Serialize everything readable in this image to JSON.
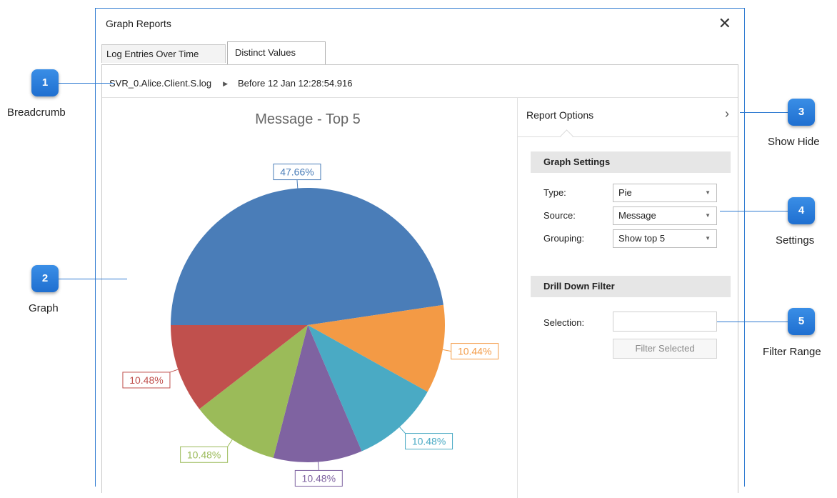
{
  "window": {
    "title": "Graph Reports",
    "close_symbol": "✕"
  },
  "tabs": [
    {
      "label": "Log Entries Over Time"
    },
    {
      "label": "Distinct Values"
    }
  ],
  "breadcrumb": {
    "items": [
      "SVR_0.Alice.Client.S.log",
      "Before 12 Jan 12:28:54.916"
    ]
  },
  "report_options": {
    "title": "Report Options",
    "toggle_symbol": "›",
    "graph_settings": {
      "header": "Graph Settings",
      "type_label": "Type:",
      "type_value": "Pie",
      "source_label": "Source:",
      "source_value": "Message",
      "grouping_label": "Grouping:",
      "grouping_value": "Show top 5"
    },
    "drill_down": {
      "header": "Drill Down Filter",
      "selection_label": "Selection:",
      "selection_value": "",
      "filter_button": "Filter Selected"
    }
  },
  "callouts": [
    {
      "number": "1",
      "label": "Breadcrumb"
    },
    {
      "number": "2",
      "label": "Graph"
    },
    {
      "number": "3",
      "label": "Show Hide"
    },
    {
      "number": "4",
      "label": "Settings"
    },
    {
      "number": "5",
      "label": "Filter Range"
    }
  ],
  "chart_data": {
    "type": "pie",
    "title": "Message - Top 5",
    "slices": [
      {
        "label": "47.66%",
        "value": 47.66,
        "color": "#4a7db8"
      },
      {
        "label": "10.44%",
        "value": 10.44,
        "color": "#f39a45"
      },
      {
        "label": "10.48%",
        "value": 10.48,
        "color": "#4aaac4"
      },
      {
        "label": "10.48%",
        "value": 10.48,
        "color": "#7f63a1"
      },
      {
        "label": "10.48%",
        "value": 10.48,
        "color": "#9bbb59"
      },
      {
        "label": "10.48%",
        "value": 10.48,
        "color": "#c0504d"
      }
    ]
  }
}
